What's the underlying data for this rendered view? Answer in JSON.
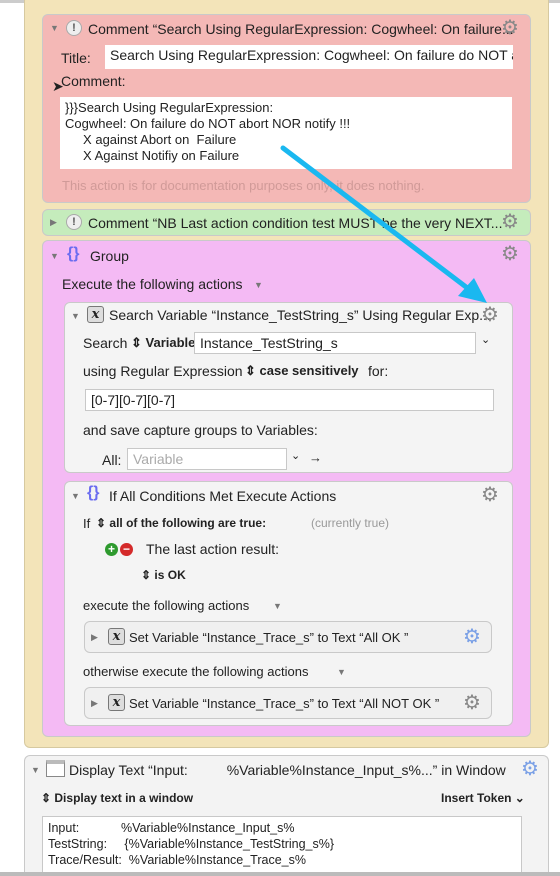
{
  "comment1": {
    "header": "Comment “Search Using RegularExpression: Cogwheel: On failure...",
    "title_label": "Title:",
    "title_value": "Search Using RegularExpression: Cogwheel: On failure do NOT abc",
    "comment_label": "Comment:",
    "comment_lines": [
      "}}}Search Using RegularExpression:",
      "Cogwheel: On failure do NOT abort NOR notify !!!",
      "     X against Abort on  Failure",
      "     X Against Notifiy on Failure"
    ],
    "note": "This action is for documentation purposes only, it does nothing."
  },
  "comment2": {
    "header": "Comment “NB Last action condition test MUST be the very  NEXT..."
  },
  "group": {
    "header": "Group",
    "execute_label": "Execute the following actions",
    "search": {
      "header": "Search Variable “Instance_TestString_s” Using Regular Exp...",
      "search_label": "Search",
      "source": "Variable",
      "variable": "Instance_TestString_s",
      "using_label": "using Regular Expression",
      "case": "case sensitively",
      "for_label": "for:",
      "regex": "[0-7][0-7][0-7]",
      "save_label": "and save capture groups to Variables:",
      "all_label": "All:",
      "all_placeholder": "Variable"
    },
    "ifblock": {
      "header": "If All Conditions Met Execute Actions",
      "if_label": "If",
      "mode": "all of the following are true:",
      "status": "(currently true)",
      "condition": "The last action result:",
      "condition_value": "is OK",
      "then_label": "execute the following actions",
      "then_action": "Set Variable “Instance_Trace_s” to Text “All  OK ”",
      "else_label": "otherwise execute the following actions",
      "else_action": "Set Variable “Instance_Trace_s” to Text “All NOT OK ”"
    }
  },
  "display": {
    "header": "Display Text “Input:          %Variable%Instance_Input_s%...” in Window",
    "mode": "Display text in a window",
    "insert_token": "Insert Token",
    "lines": [
      "Input:            %Variable%Instance_Input_s%",
      "TestString:     {%Variable%Instance_TestString_s%}",
      "Trace/Result:  %Variable%Instance_Trace_s%"
    ]
  },
  "colors": {
    "comment_red": "#f4b8b6",
    "comment_green": "#c5ecbc",
    "group_pink": "#f4baf4",
    "outer_yellow": "#f3e4b9",
    "arrow": "#1ab8f0"
  }
}
